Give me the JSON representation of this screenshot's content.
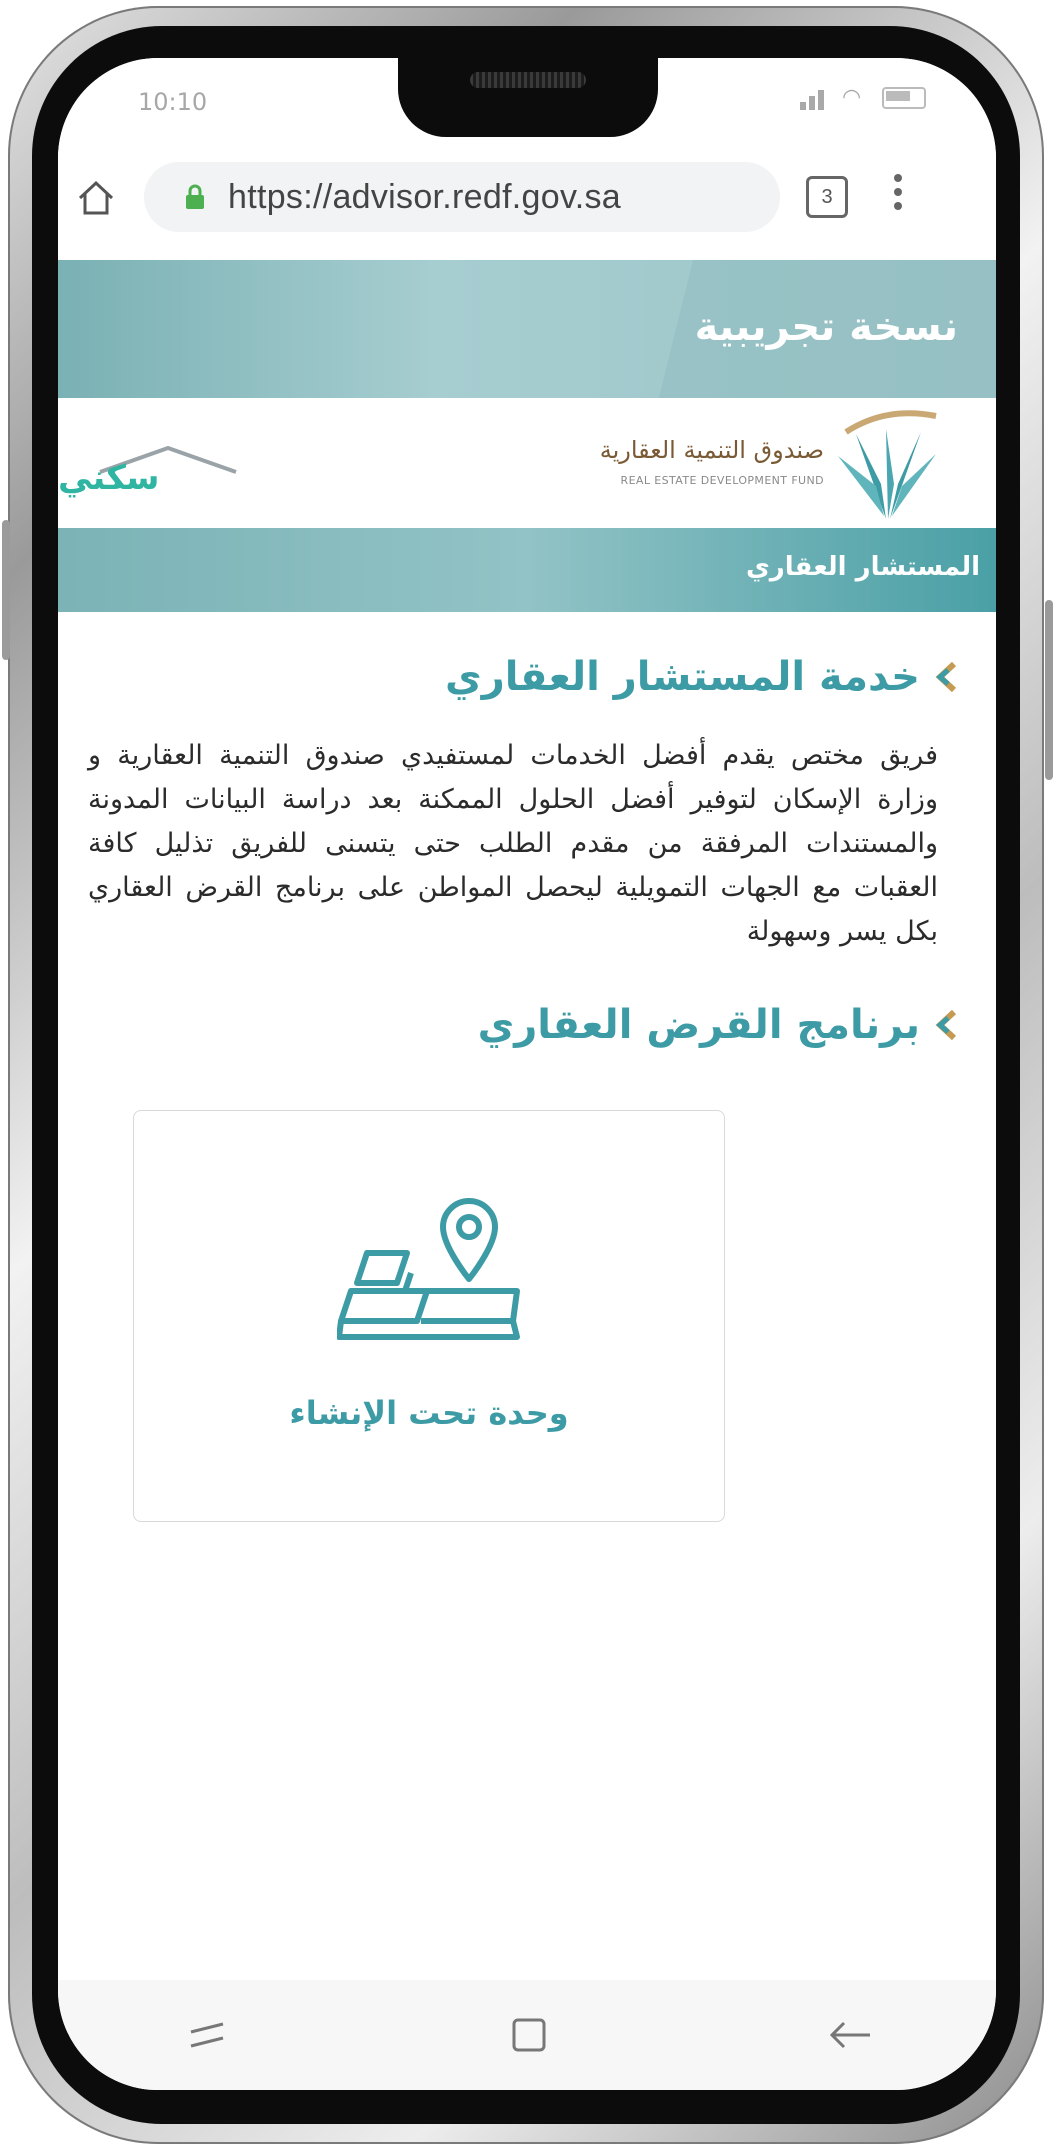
{
  "status_bar": {
    "time": "10:10"
  },
  "browser": {
    "url": "https://advisor.redf.gov.sa",
    "tab_count": "3"
  },
  "banner": {
    "beta_label": "نسخة تجريبية"
  },
  "logos": {
    "sakani": "سكني",
    "redf_arabic": "صندوق التنمية العقارية",
    "redf_english": "REAL ESTATE DEVELOPMENT FUND"
  },
  "page": {
    "band_title": "المستشار العقاري",
    "service_heading": "خدمة المستشار العقاري",
    "service_description": "فريق مختص يقدم أفضل الخدمات لمستفيدي صندوق التنمية العقارية و وزارة الإسكان لتوفير أفضل الحلول الممكنة بعد دراسة البيانات المدونة والمستندات المرفقة من مقدم الطلب حتى يتسنى للفريق تذليل كافة العقبات مع الجهات التمويلية ليحصل المواطن على برنامج القرض العقاري بكل يسر وسهولة",
    "program_heading": "برنامج القرض العقاري",
    "card_label": "وحدة تحت الإنشاء"
  },
  "colors": {
    "accent": "#3d9ba5",
    "banner": "#9dc6c9",
    "arrow_gold": "#c59a52"
  },
  "icons": [
    "home-icon",
    "lock-icon",
    "tabs-icon",
    "menu-icon",
    "chevron-icon",
    "map-pin-icon",
    "recent-apps-icon",
    "home-button-icon",
    "back-icon"
  ]
}
